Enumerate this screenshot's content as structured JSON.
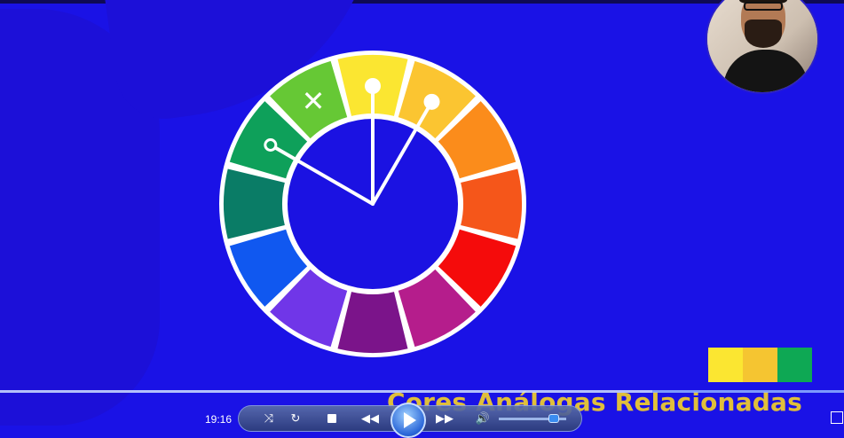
{
  "video": {
    "caption": "Cores Análogas Relacionadas",
    "background_color": "#1a12e6",
    "color_wheel": {
      "segments": [
        "#fbe631",
        "#fbc531",
        "#fb8c1b",
        "#f5561a",
        "#f50b0b",
        "#b51d8c",
        "#7b148a",
        "#7036e8",
        "#1058f0",
        "#0a7c66",
        "#0ea05a",
        "#66c835"
      ],
      "excluded_marker": "✕",
      "selected_segments": [
        "#fbe631",
        "#fbc531"
      ],
      "hollow_marker_segment": "#0ea05a"
    },
    "palette_swatches": [
      "#fbe631",
      "#f5c531",
      "#0ea854"
    ],
    "webcam": {
      "icon": "presenter-avatar"
    }
  },
  "player": {
    "time": "19:16",
    "progress_fraction": 0.773,
    "volume_fraction": 0.82,
    "icons": {
      "shuffle": "shuffle-icon",
      "repeat": "repeat-icon",
      "stop": "stop-icon",
      "previous": "previous-icon",
      "play": "play-icon",
      "next": "next-icon",
      "volume": "volume-icon",
      "switch_view": "switch-view-icon"
    },
    "glyphs": {
      "shuffle": "⤨",
      "repeat": "↻",
      "previous": "◀◀",
      "next": "▶▶",
      "volume": "🔊"
    }
  }
}
